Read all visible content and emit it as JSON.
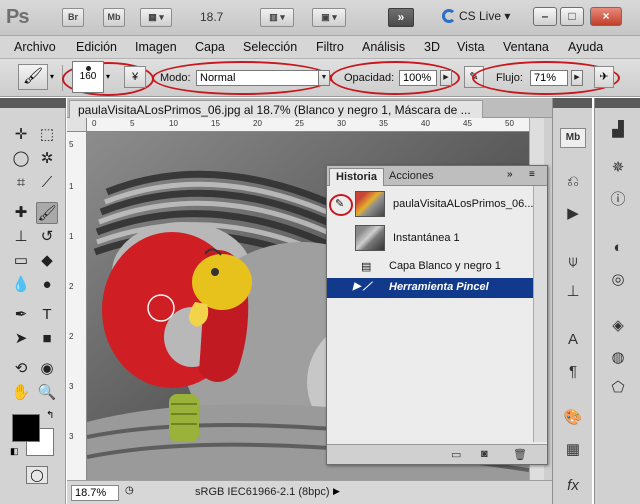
{
  "appbar": {
    "logo": "Ps",
    "br": "Br",
    "mb": "Mb",
    "zoom": "18.7",
    "cs_live": "CS Live",
    "win_min": "–",
    "win_max": "□",
    "win_close": "×"
  },
  "menu": [
    "Archivo",
    "Edición",
    "Imagen",
    "Capa",
    "Selección",
    "Filtro",
    "Análisis",
    "3D",
    "Vista",
    "Ventana",
    "Ayuda"
  ],
  "options": {
    "brush_size": "160",
    "mode_label": "Modo:",
    "mode_value": "Normal",
    "opacity_label": "Opacidad:",
    "opacity_value": "100%",
    "flow_label": "Flujo:",
    "flow_value": "71%"
  },
  "document": {
    "tab_title": "paulaVisitaALosPrimos_06.jpg al 18.7% (Blanco y negro 1, Máscara de ...",
    "ruler_h": [
      "0",
      "5",
      "10",
      "15",
      "20",
      "25",
      "30",
      "35",
      "40",
      "45",
      "50"
    ],
    "ruler_v": [
      "5",
      "1",
      "1",
      "2",
      "2",
      "3",
      "3"
    ],
    "zoom": "18.7%",
    "status": "sRGB IEC61966-2.1 (8bpc)"
  },
  "history": {
    "tab_history": "Historia",
    "tab_actions": "Acciones",
    "rows": [
      "paulaVisitaALosPrimos_06....",
      "Instantánea 1",
      "Capa Blanco y negro 1",
      "Herramienta Pincel"
    ]
  },
  "colors": {
    "highlight_red": "#c8181d",
    "selection_blue": "#123a8c",
    "toy_red": "#d01e25",
    "toy_yellow": "#e8c21c",
    "toy_green": "#9ab23a"
  }
}
